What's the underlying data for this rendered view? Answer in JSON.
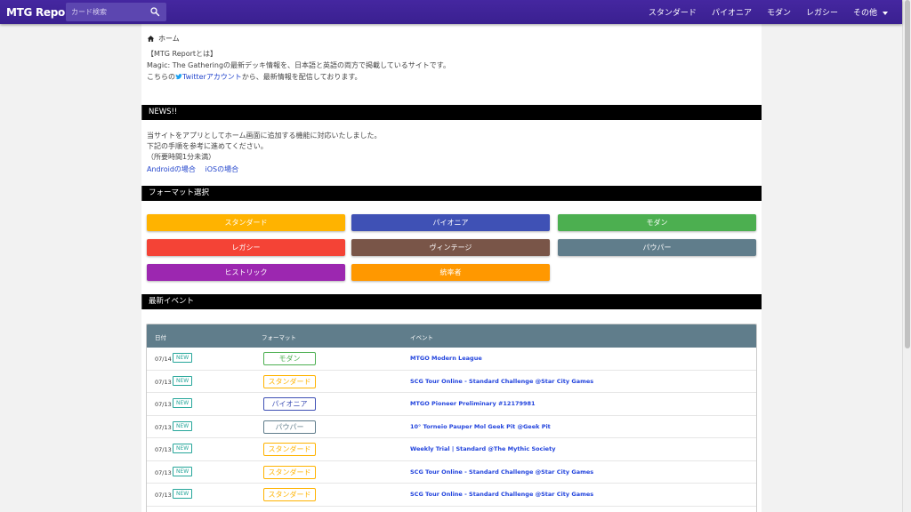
{
  "navbar": {
    "brand": "MTG Report",
    "search_placeholder": "カード検索",
    "links": [
      "スタンダード",
      "パイオニア",
      "モダン",
      "レガシー",
      "その他"
    ]
  },
  "breadcrumb": {
    "home": "ホーム"
  },
  "intro": {
    "line1": "【MTG Reportとは】",
    "line2": "Magic: The Gatheringの最新デッキ情報を、日本語と英語の両方で掲載しているサイトです。",
    "line3_pre": "こちらの",
    "line3_link": "Twitterアカウント",
    "line3_post": "から、最新情報を配信しております。"
  },
  "news": {
    "title": "NEWS!!",
    "line1": "当サイトをアプリとしてホーム画面に追加する機能に対応いたしました。",
    "line2": "下記の手順を参考に進めてください。",
    "line3": "（所要時間1分未満）",
    "android": "Androidの場合",
    "ios": "iOSの場合"
  },
  "formats": {
    "title": "フォーマット選択",
    "buttons": [
      {
        "label": "スタンダード",
        "color": "#ffb300"
      },
      {
        "label": "パイオニア",
        "color": "#3f51b5"
      },
      {
        "label": "モダン",
        "color": "#4caf50"
      },
      {
        "label": "レガシー",
        "color": "#f44336"
      },
      {
        "label": "ヴィンテージ",
        "color": "#795548"
      },
      {
        "label": "パウパー",
        "color": "#607d8b"
      },
      {
        "label": "ヒストリック",
        "color": "#9c27b0"
      },
      {
        "label": "統率者",
        "color": "#ff9800"
      }
    ]
  },
  "events": {
    "title": "最新イベント",
    "headers": {
      "date": "日付",
      "format": "フォーマット",
      "event": "イベント"
    },
    "new_label": "NEW",
    "rows": [
      {
        "date": "07/14",
        "format": "モダン",
        "color": "#4caf50",
        "event": "MTGO Modern League"
      },
      {
        "date": "07/13",
        "format": "スタンダード",
        "color": "#ffb300",
        "event": "SCG Tour Online - Standard Challenge @Star City Games"
      },
      {
        "date": "07/13",
        "format": "パイオニア",
        "color": "#3f51b5",
        "event": "MTGO Pioneer Preliminary #12179981"
      },
      {
        "date": "07/13",
        "format": "パウパー",
        "color": "#607d8b",
        "event": "10° Torneio Pauper Mol Geek Pit @Geek Pit"
      },
      {
        "date": "07/13",
        "format": "スタンダード",
        "color": "#ffb300",
        "event": "Weekly Trial | Standard @The Mythic Society"
      },
      {
        "date": "07/13",
        "format": "スタンダード",
        "color": "#ffb300",
        "event": "SCG Tour Online - Standard Challenge @Star City Games"
      },
      {
        "date": "07/13",
        "format": "スタンダード",
        "color": "#ffb300",
        "event": "SCG Tour Online - Standard Challenge @Star City Games"
      }
    ]
  }
}
